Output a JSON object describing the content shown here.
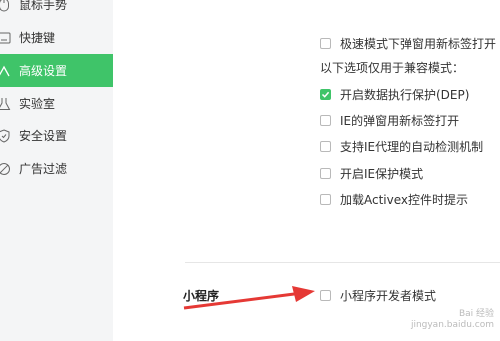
{
  "sidebar": {
    "items": [
      {
        "label": "鼠标手势",
        "icon": "mouse-icon"
      },
      {
        "label": "快捷键",
        "icon": "keyboard-icon"
      },
      {
        "label": "高级设置",
        "icon": "advanced-settings-icon",
        "active": true
      },
      {
        "label": "实验室",
        "icon": "lab-flask-icon"
      },
      {
        "label": "安全设置",
        "icon": "shield-icon"
      },
      {
        "label": "广告过滤",
        "icon": "block-icon"
      }
    ]
  },
  "options": {
    "popup_new_tab_speed": {
      "label": "极速模式下弹窗用新标签打开",
      "checked": false
    },
    "compat_note": "以下选项仅用于兼容模式：",
    "dep": {
      "label": "开启数据执行保护(DEP)",
      "checked": true
    },
    "ie_popup": {
      "label": "IE的弹窗用新标签打开",
      "checked": false
    },
    "ie_proxy": {
      "label": "支持IE代理的自动检测机制",
      "checked": false
    },
    "ie_protected": {
      "label": "开启IE保护模式",
      "checked": false
    },
    "activex_prompt": {
      "label": "加载Activex控件时提示",
      "checked": false
    }
  },
  "mini_program": {
    "section_label": "小程序",
    "dev_mode": {
      "label": "小程序开发者模式",
      "checked": false
    }
  },
  "watermark": {
    "line1": "Bai 经验",
    "line2": "jingyan.baidu.com"
  },
  "colors": {
    "accent": "#3fc469",
    "arrow": "#e53935"
  }
}
